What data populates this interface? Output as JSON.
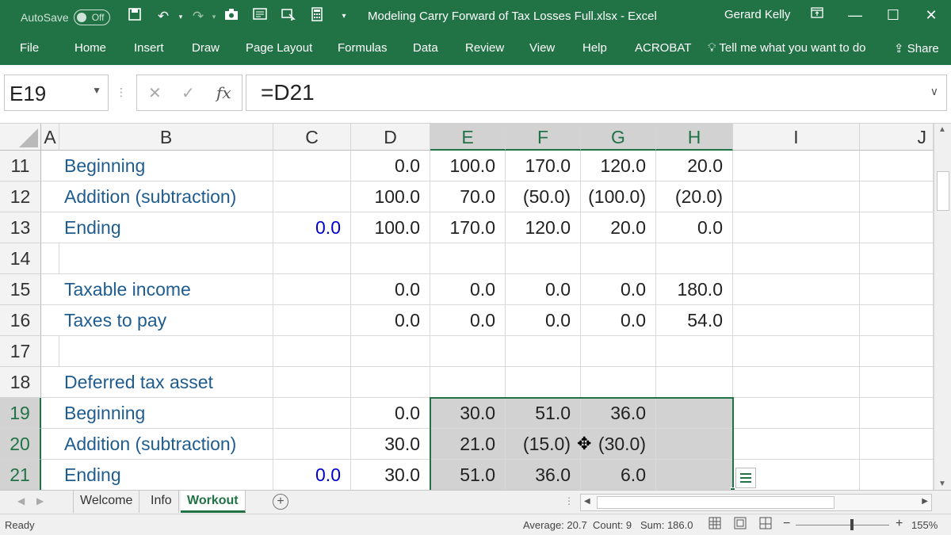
{
  "titlebar": {
    "autosave_label": "AutoSave",
    "autosave_state": "Off",
    "document_title": "Modeling Carry Forward of Tax Losses Full.xlsx  -  Excel",
    "user_name": "Gerard Kelly"
  },
  "ribbon": {
    "tabs": [
      "File",
      "Home",
      "Insert",
      "Draw",
      "Page Layout",
      "Formulas",
      "Data",
      "Review",
      "View",
      "Help",
      "ACROBAT"
    ],
    "tell_me": "Tell me what you want to do",
    "share": "Share"
  },
  "formula_bar": {
    "name_box": "E19",
    "fx": "fx",
    "formula": "=D21"
  },
  "columns": [
    "A",
    "B",
    "C",
    "D",
    "E",
    "F",
    "G",
    "H",
    "I",
    "J"
  ],
  "rows": [
    {
      "num": "11",
      "B": "Beginning",
      "C": "",
      "D": "0.0",
      "E": "100.0",
      "F": "170.0",
      "G": "120.0",
      "H": "20.0"
    },
    {
      "num": "12",
      "B": "Addition (subtraction)",
      "C": "",
      "D": "100.0",
      "E": "70.0",
      "F": "(50.0)",
      "G": "(100.0)",
      "H": "(20.0)"
    },
    {
      "num": "13",
      "B": "Ending",
      "C": "0.0",
      "D": "100.0",
      "E": "170.0",
      "F": "120.0",
      "G": "20.0",
      "H": "0.0"
    },
    {
      "num": "14",
      "B": "",
      "C": "",
      "D": "",
      "E": "",
      "F": "",
      "G": "",
      "H": ""
    },
    {
      "num": "15",
      "B": "Taxable income",
      "C": "",
      "D": "0.0",
      "E": "0.0",
      "F": "0.0",
      "G": "0.0",
      "H": "180.0"
    },
    {
      "num": "16",
      "B": "Taxes to pay",
      "C": "",
      "D": "0.0",
      "E": "0.0",
      "F": "0.0",
      "G": "0.0",
      "H": "54.0"
    },
    {
      "num": "17",
      "B": "",
      "C": "",
      "D": "",
      "E": "",
      "F": "",
      "G": "",
      "H": ""
    },
    {
      "num": "18",
      "B": "Deferred tax asset",
      "C": "",
      "D": "",
      "E": "",
      "F": "",
      "G": "",
      "H": ""
    },
    {
      "num": "19",
      "B": "Beginning",
      "C": "",
      "D": "0.0",
      "E": "30.0",
      "F": "51.0",
      "G": "36.0",
      "H": ""
    },
    {
      "num": "20",
      "B": "Addition (subtraction)",
      "C": "",
      "D": "30.0",
      "E": "21.0",
      "F": "(15.0)",
      "G": "(30.0)",
      "H": ""
    },
    {
      "num": "21",
      "B": "Ending",
      "C": "0.0",
      "D": "30.0",
      "E": "51.0",
      "F": "36.0",
      "G": "6.0",
      "H": ""
    }
  ],
  "sheets": [
    "Welcome",
    "Info",
    "Workout"
  ],
  "active_sheet": "Workout",
  "status": {
    "ready": "Ready",
    "average": "Average: 20.7",
    "count": "Count: 9",
    "sum": "Sum: 186.0",
    "zoom": "155%"
  }
}
